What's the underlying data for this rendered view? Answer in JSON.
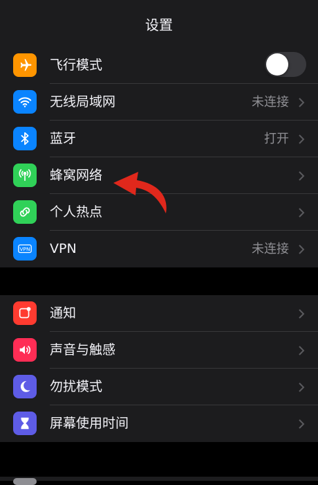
{
  "header": {
    "title": "设置"
  },
  "groups": [
    {
      "rows": [
        {
          "label": "飞行模式",
          "icon": "airplane-icon",
          "color": "#ff9500",
          "toggle": false
        },
        {
          "label": "无线局域网",
          "icon": "wifi-icon",
          "color": "#0a84ff",
          "value": "未连接"
        },
        {
          "label": "蓝牙",
          "icon": "bluetooth-icon",
          "color": "#0a84ff",
          "value": "打开"
        },
        {
          "label": "蜂窝网络",
          "icon": "cellular-antenna-icon",
          "color": "#30d158"
        },
        {
          "label": "个人热点",
          "icon": "hotspot-chain-icon",
          "color": "#30d158"
        },
        {
          "label": "VPN",
          "icon": "vpn-icon",
          "color": "#0a84ff",
          "value": "未连接"
        }
      ]
    },
    {
      "rows": [
        {
          "label": "通知",
          "icon": "notification-icon",
          "color": "#ff3b30"
        },
        {
          "label": "声音与触感",
          "icon": "speaker-icon",
          "color": "#ff2d55"
        },
        {
          "label": "勿扰模式",
          "icon": "moon-icon",
          "color": "#5e5ce6"
        },
        {
          "label": "屏幕使用时间",
          "icon": "hourglass-icon",
          "color": "#5e5ce6"
        }
      ]
    }
  ],
  "annotation": {
    "icon": "red-curved-arrow-icon",
    "color": "#e0281c"
  }
}
